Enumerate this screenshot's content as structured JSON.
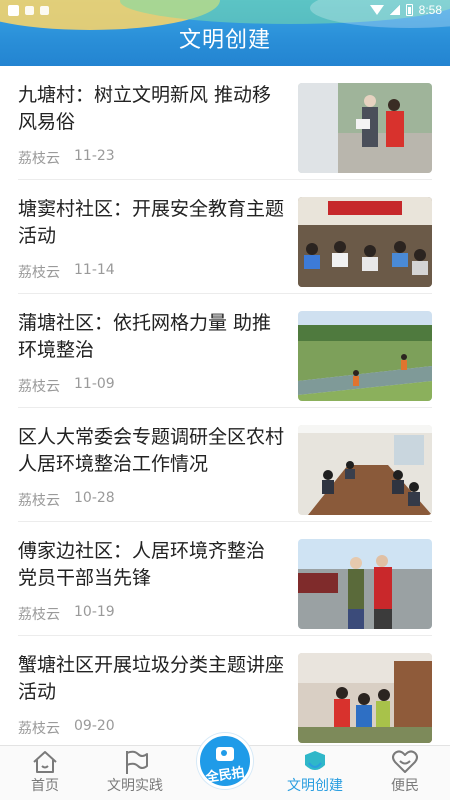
{
  "status_bar": {
    "time": "8:58"
  },
  "header": {
    "title": "文明创建"
  },
  "articles": [
    {
      "title": "九塘村：树立文明新风 推动移风易俗",
      "source": "荔枝云",
      "date": "11-23"
    },
    {
      "title": "塘窦村社区：开展安全教育主题活动",
      "source": "荔枝云",
      "date": "11-14"
    },
    {
      "title": "蒲塘社区：依托网格力量 助推环境整治",
      "source": "荔枝云",
      "date": "11-09"
    },
    {
      "title": "区人大常委会专题调研全区农村人居环境整治工作情况",
      "source": "荔枝云",
      "date": "10-28"
    },
    {
      "title": "傅家边社区：人居环境齐整治 党员干部当先锋",
      "source": "荔枝云",
      "date": "10-19"
    },
    {
      "title": "蟹塘社区开展垃圾分类主题讲座活动",
      "source": "荔枝云",
      "date": "09-20"
    }
  ],
  "bottom_nav": {
    "items": [
      {
        "label": "首页",
        "icon": "home-icon"
      },
      {
        "label": "文明实践",
        "icon": "flag-icon"
      },
      {
        "label": "文明创建",
        "icon": "civilization-icon",
        "active": true
      },
      {
        "label": "便民",
        "icon": "heart-icon"
      }
    ],
    "center": {
      "label": "全民拍",
      "icon": "camera-icon"
    }
  },
  "colors": {
    "accent": "#2a9ee0",
    "header": "#2a8fd8",
    "text": "#222222",
    "meta": "#9a9a9a"
  }
}
